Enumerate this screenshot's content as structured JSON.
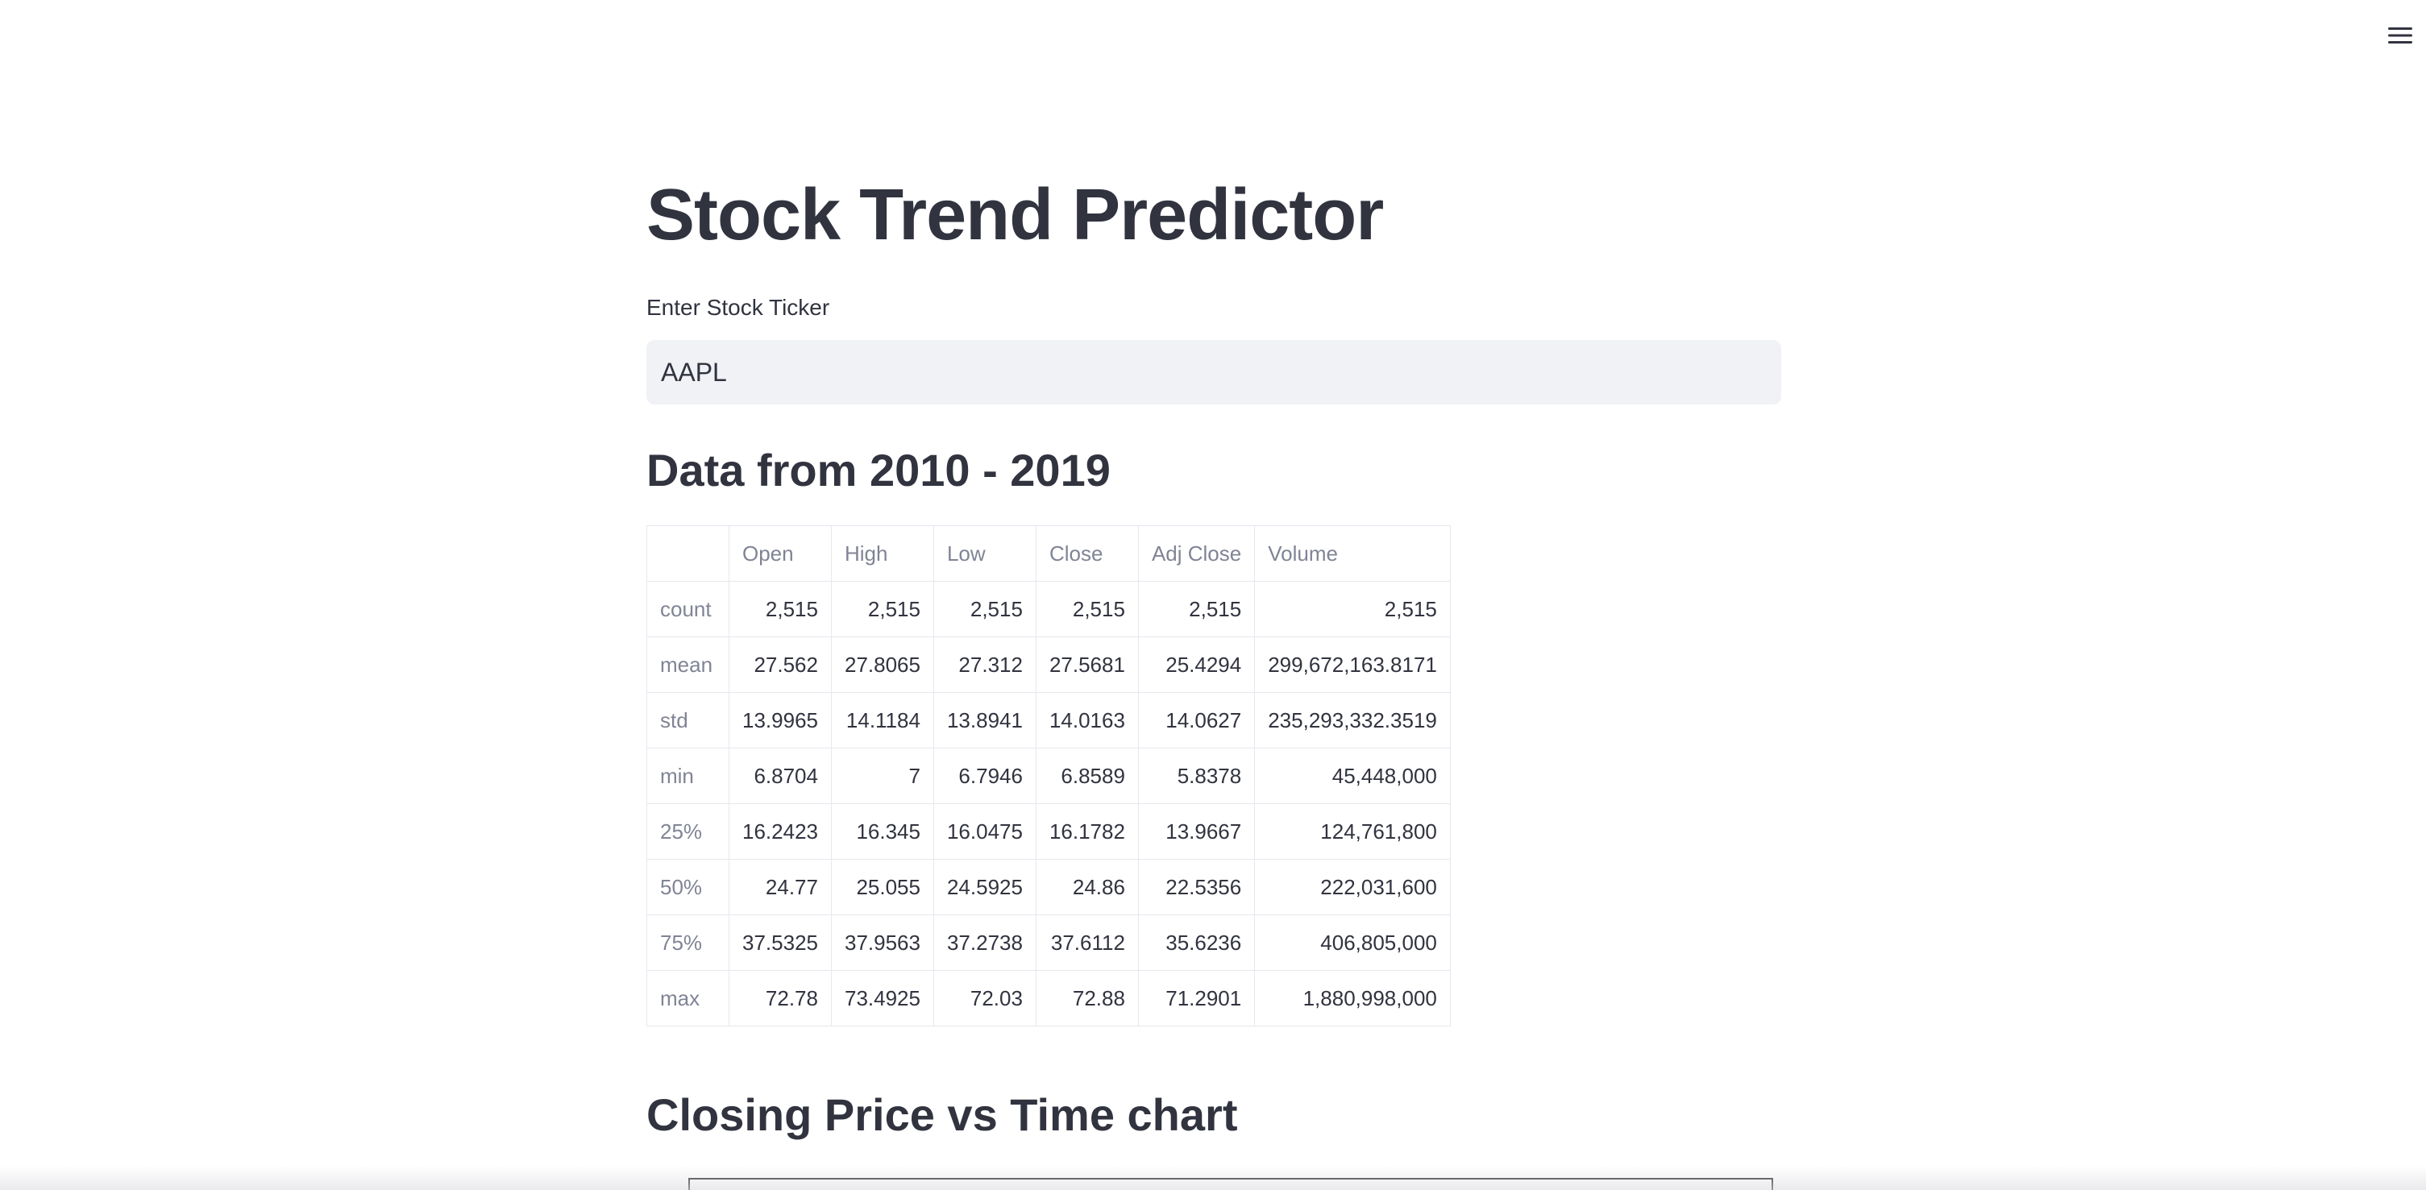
{
  "app": {
    "title": "Stock Trend Predictor"
  },
  "menu": {
    "icon": "hamburger-menu-icon"
  },
  "ticker_input": {
    "label": "Enter Stock Ticker",
    "value": "AAPL"
  },
  "data_section": {
    "title": "Data from 2010 - 2019"
  },
  "stats_table": {
    "columns": [
      "",
      "Open",
      "High",
      "Low",
      "Close",
      "Adj Close",
      "Volume"
    ],
    "rows": [
      {
        "label": "count",
        "values": [
          "2,515",
          "2,515",
          "2,515",
          "2,515",
          "2,515",
          "2,515"
        ]
      },
      {
        "label": "mean",
        "values": [
          "27.562",
          "27.8065",
          "27.312",
          "27.5681",
          "25.4294",
          "299,672,163.8171"
        ]
      },
      {
        "label": "std",
        "values": [
          "13.9965",
          "14.1184",
          "13.8941",
          "14.0163",
          "14.0627",
          "235,293,332.3519"
        ]
      },
      {
        "label": "min",
        "values": [
          "6.8704",
          "7",
          "6.7946",
          "6.8589",
          "5.8378",
          "45,448,000"
        ]
      },
      {
        "label": "25%",
        "values": [
          "16.2423",
          "16.345",
          "16.0475",
          "16.1782",
          "13.9667",
          "124,761,800"
        ]
      },
      {
        "label": "50%",
        "values": [
          "24.77",
          "25.055",
          "24.5925",
          "24.86",
          "22.5356",
          "222,031,600"
        ]
      },
      {
        "label": "75%",
        "values": [
          "37.5325",
          "37.9563",
          "37.2738",
          "37.6112",
          "35.6236",
          "406,805,000"
        ]
      },
      {
        "label": "max",
        "values": [
          "72.78",
          "73.4925",
          "72.03",
          "72.88",
          "71.2901",
          "1,880,998,000"
        ]
      }
    ]
  },
  "chart_section": {
    "title": "Closing Price vs Time chart"
  }
}
